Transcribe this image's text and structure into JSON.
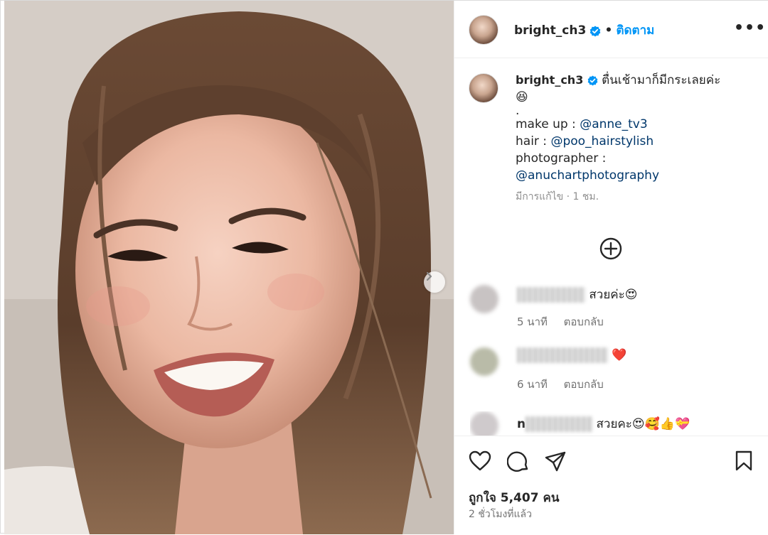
{
  "post": {
    "username": "bright_ch3",
    "follow_label": "ติดตาม",
    "separator": "•",
    "more_label": "•••"
  },
  "caption": {
    "username": "bright_ch3",
    "text": "ตื่นเช้ามาก็มีกระเลยค่ะ",
    "emoji": "😆",
    "dot_line": ".",
    "line1_label": "make up : ",
    "line1_mention": "@anne_tv3",
    "line2_label": "hair : ",
    "line2_mention": "@poo_hairstylish",
    "line3_label": "photographer :",
    "line3_mention": "@anuchartphotography",
    "meta": "มีการแก้ไข · 1 ชม."
  },
  "comments": [
    {
      "name_prefix": "",
      "text": "สวยค่ะ😍",
      "age": "5 นาที",
      "reply_label": "ตอบกลับ"
    },
    {
      "name_prefix": "",
      "text": "❤️",
      "age": "6 นาที",
      "reply_label": "ตอบกลับ"
    },
    {
      "name_prefix": "n",
      "text": "สวยคะ😍🥰👍💝",
      "age": "",
      "reply_label": ""
    }
  ],
  "footer": {
    "likes": "ถูกใจ 5,407 คน",
    "time": "2 ชั่วโมงที่แล้ว"
  },
  "colors": {
    "accent": "#0095f6",
    "mention": "#00376b",
    "muted": "#737373",
    "verified": "#0095f6"
  },
  "icons": [
    "verified-badge-icon",
    "more-options-icon",
    "add-comments-icon",
    "heart-icon",
    "comment-icon",
    "share-icon",
    "save-icon",
    "chevron-right-icon"
  ]
}
